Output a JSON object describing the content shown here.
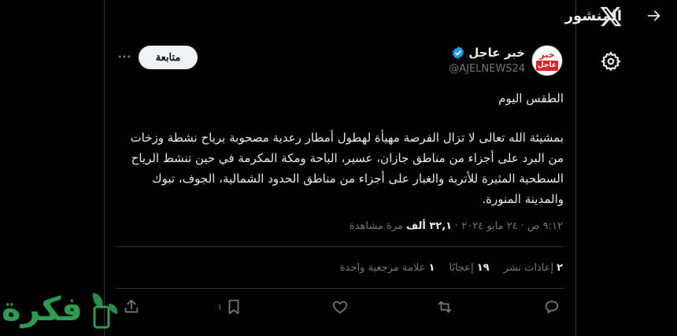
{
  "header": {
    "title": "المنشور"
  },
  "tweet": {
    "author_name": "خبر عاجل",
    "handle": "@AJELNEWS24",
    "avatar_top": "خبر",
    "avatar_bottom": "عاجل",
    "follow_label": "متابعة",
    "title": "الطقس اليوم",
    "body": "بمشيئة الله تعالى لا تزال الفرصة مهيأة لهطول أمطار رعدية مصحوبة برياح نشطة وزخات من البرد على أجزاء من مناطق جازان، عسير، الباحة ومكة المكرمة في حين تنشط الرياح السطحية المثيرة للأتربة والغبار على أجزاء من مناطق الحدود الشمالية، الجوف، تبوك والمدينة المنورة.",
    "time": "٩:١٢ ص",
    "date": "٢٤ مايو ٢٠٢٤",
    "sep": "·",
    "views_num": "٣٢,١ ألف",
    "views_label": "مرة مشاهدة"
  },
  "stats": {
    "reposts_num": "٢",
    "reposts_label": "إعادات نشر",
    "likes_num": "١٩",
    "likes_label": "إعجابًا",
    "bookmarks_num": "١",
    "bookmarks_label": "علامة مرجعية واحدة"
  },
  "actions": {
    "bookmark_count": "١"
  },
  "watermark": {
    "text": "فكرة"
  },
  "colors": {
    "bg": "#000000",
    "text": "#e7e9ea",
    "muted": "#71767b",
    "border": "#2f3336",
    "verified": "#1d9bf0",
    "brand_red": "#d8232a"
  }
}
